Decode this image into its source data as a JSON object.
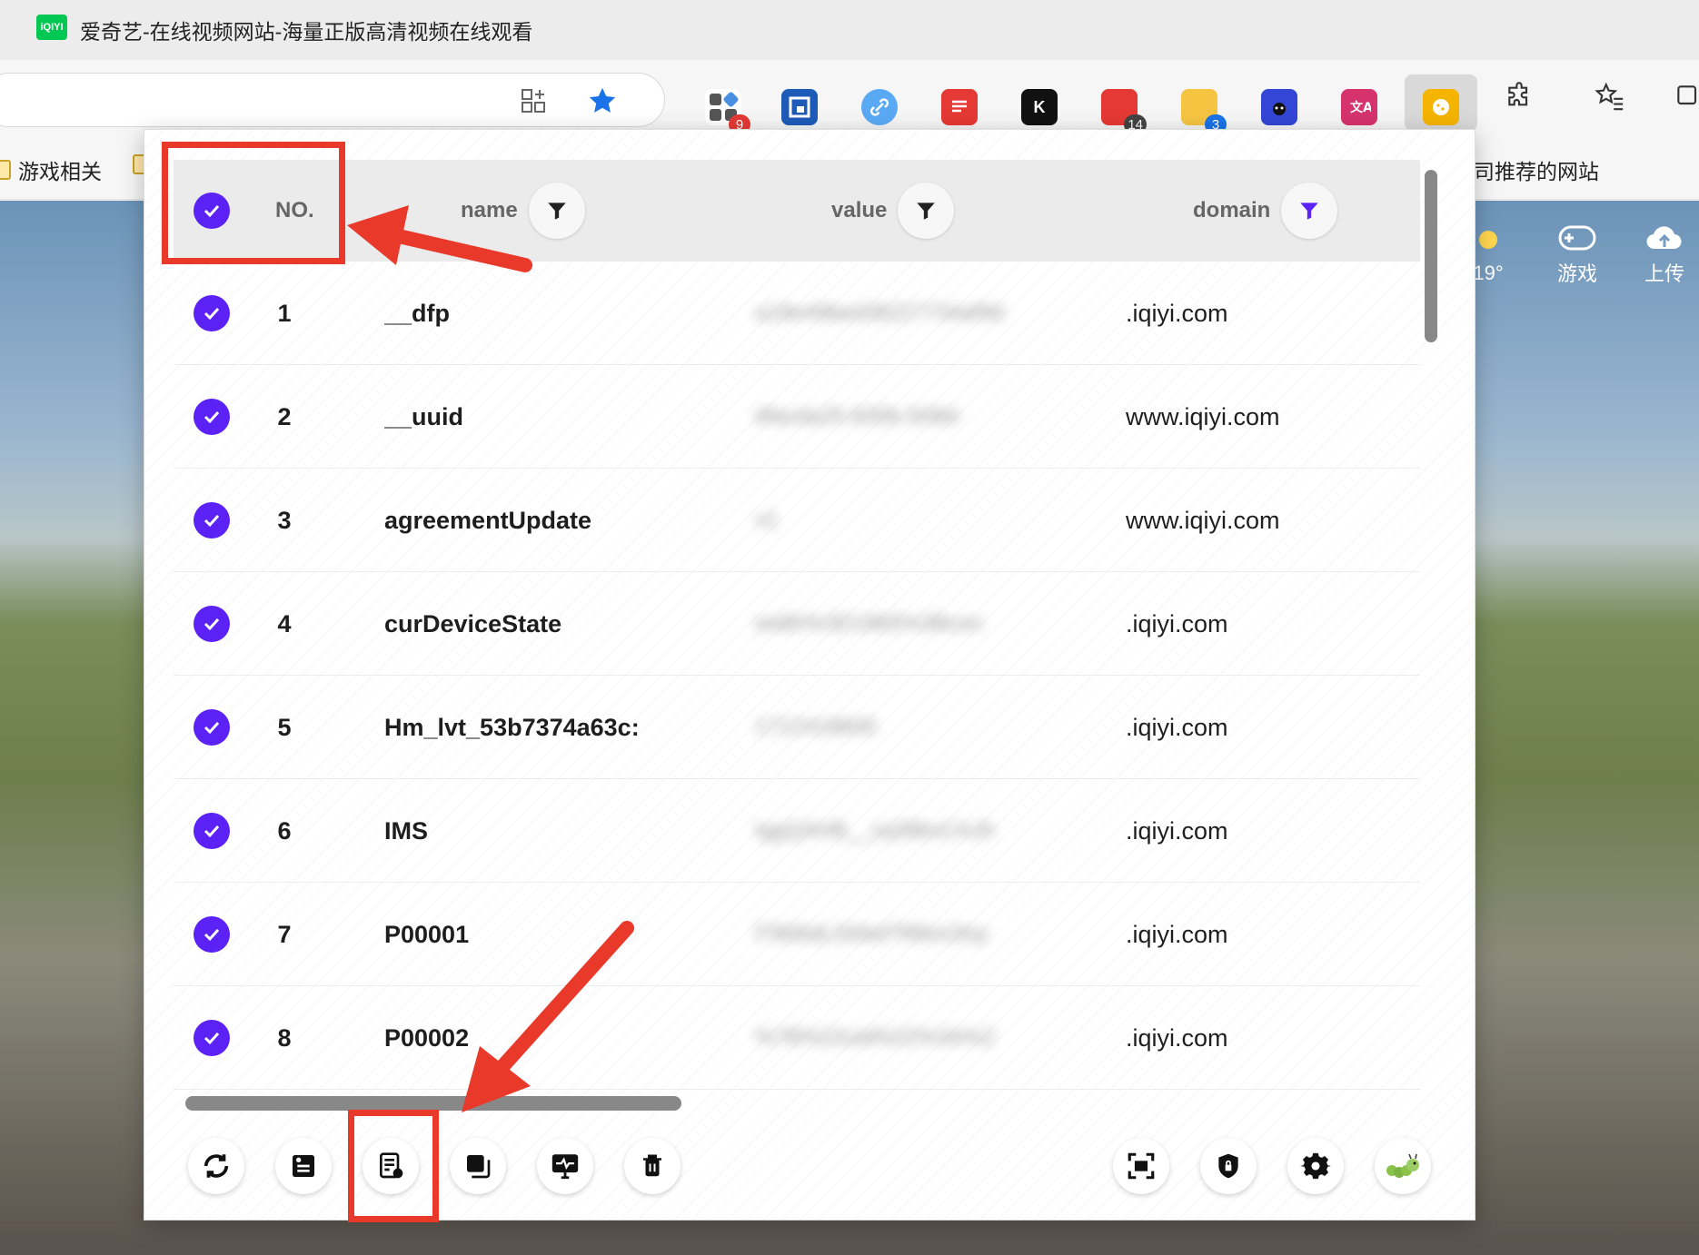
{
  "browser": {
    "tab_favicon_text": "iQIYI",
    "tab_title": "爱奇艺-在线视频网站-海量正版高清视频在线观看",
    "extension_badges": {
      "ext1": "9",
      "ext6": "14",
      "ext7": "3"
    },
    "bookmarks": {
      "item1": "游戏相关",
      "item3": "司推荐的网站"
    }
  },
  "page": {
    "weather_temp": "19°",
    "games_label": "游戏",
    "upload_label": "上传"
  },
  "popup": {
    "header": {
      "no_label": "NO.",
      "name_label": "name",
      "value_label": "value",
      "domain_label": "domain"
    },
    "rows": [
      {
        "no": "1",
        "name": "__dfp",
        "value": "a18e49bed38227734af9d",
        "domain": ".iqiyi.com"
      },
      {
        "no": "2",
        "name": "__uuid",
        "value": "dfacda25-830b-508d-",
        "domain": "www.iqiyi.com"
      },
      {
        "no": "3",
        "name": "agreementUpdate",
        "value": "v1",
        "domain": "www.iqiyi.com"
      },
      {
        "no": "4",
        "name": "curDeviceState",
        "value": "width%3D1865%3Bcon",
        "domain": ".iqiyi.com"
      },
      {
        "no": "5",
        "name": "Hm_lvt_53b7374a63c:",
        "value": "1712418600",
        "domain": ".iqiyi.com"
      },
      {
        "no": "6",
        "name": "IMS",
        "value": "IggQAHB__xq38bxCAJh",
        "domain": ".iqiyi.com"
      },
      {
        "no": "7",
        "name": "P00001",
        "value": "f7866dL556ef7f96m2Kp",
        "domain": ".iqiyi.com"
      },
      {
        "no": "8",
        "name": "P00002",
        "value": "%7B%22uid%22%3A%2",
        "domain": ".iqiyi.com"
      }
    ]
  },
  "colors": {
    "accent": "#5b21f5",
    "annotation": "#e8392b",
    "header_bg": "#ebebeb"
  }
}
